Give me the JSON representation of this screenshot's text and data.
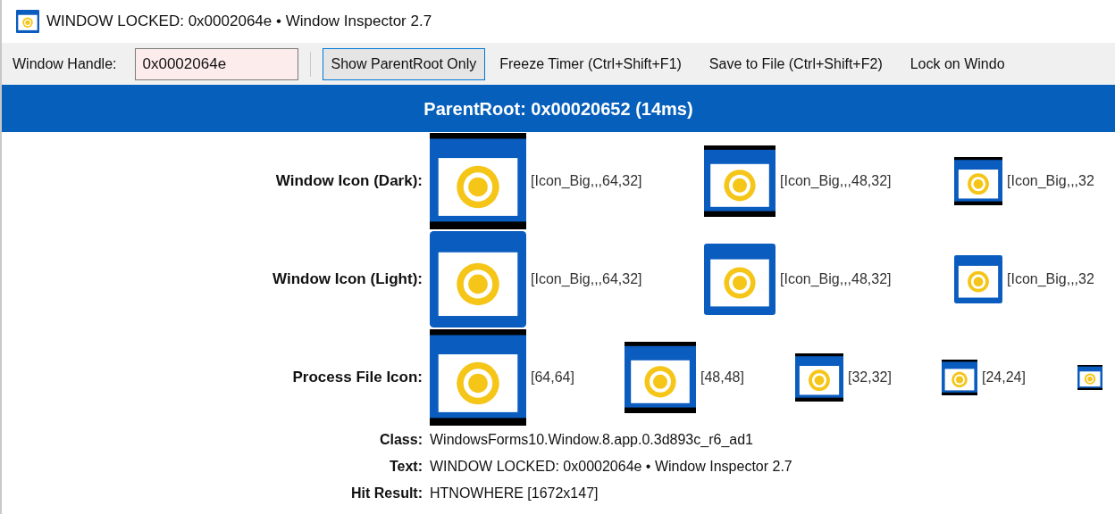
{
  "window": {
    "title": "WINDOW LOCKED: 0x0002064e • Window Inspector 2.7"
  },
  "toolbar": {
    "handle_label": "Window Handle:",
    "handle_value": "0x0002064e",
    "buttons": [
      {
        "label": "Show ParentRoot Only",
        "kind": "outlined"
      },
      {
        "label": "Freeze Timer (Ctrl+Shift+F1)",
        "kind": "flat"
      },
      {
        "label": "Save to File (Ctrl+Shift+F2)",
        "kind": "flat"
      },
      {
        "label": "Lock on Windo",
        "kind": "flat"
      }
    ]
  },
  "header": "ParentRoot: 0x00020652 (14ms)",
  "icon_rows": [
    {
      "label": "Window Icon (Dark):",
      "kind": "dark",
      "icons": [
        {
          "kind": "large",
          "caption": "[Icon_Big,,,64,32]"
        },
        {
          "kind": "medium",
          "caption": "[Icon_Big,,,48,32]"
        },
        {
          "kind": "small",
          "caption": "[Icon_Big,,,32"
        }
      ]
    },
    {
      "label": "Window Icon (Light):",
      "kind": "light",
      "icons": [
        {
          "kind": "large",
          "caption": "[Icon_Big,,,64,32]"
        },
        {
          "kind": "medium",
          "caption": "[Icon_Big,,,48,32]"
        },
        {
          "kind": "small",
          "caption": "[Icon_Big,,,32"
        }
      ]
    },
    {
      "label": "Process File Icon:",
      "kind": "file",
      "icons": [
        {
          "kind": "large",
          "caption": "[64,64]"
        },
        {
          "kind": "medium",
          "caption": "[48,48]"
        },
        {
          "kind": "small",
          "caption": "[32,32]"
        },
        {
          "kind": "xsmall",
          "caption": "[24,24]"
        },
        {
          "kind": "tiny"
        }
      ]
    }
  ],
  "properties": [
    {
      "label": "Class:",
      "value": "WindowsForms10.Window.8.app.0.3d893c_r6_ad1"
    },
    {
      "label": "Text:",
      "value": "WINDOW LOCKED: 0x0002064e • Window Inspector 2.7"
    },
    {
      "label": "Hit Result:",
      "value": "HTNOWHERE [1672x147]"
    }
  ]
}
